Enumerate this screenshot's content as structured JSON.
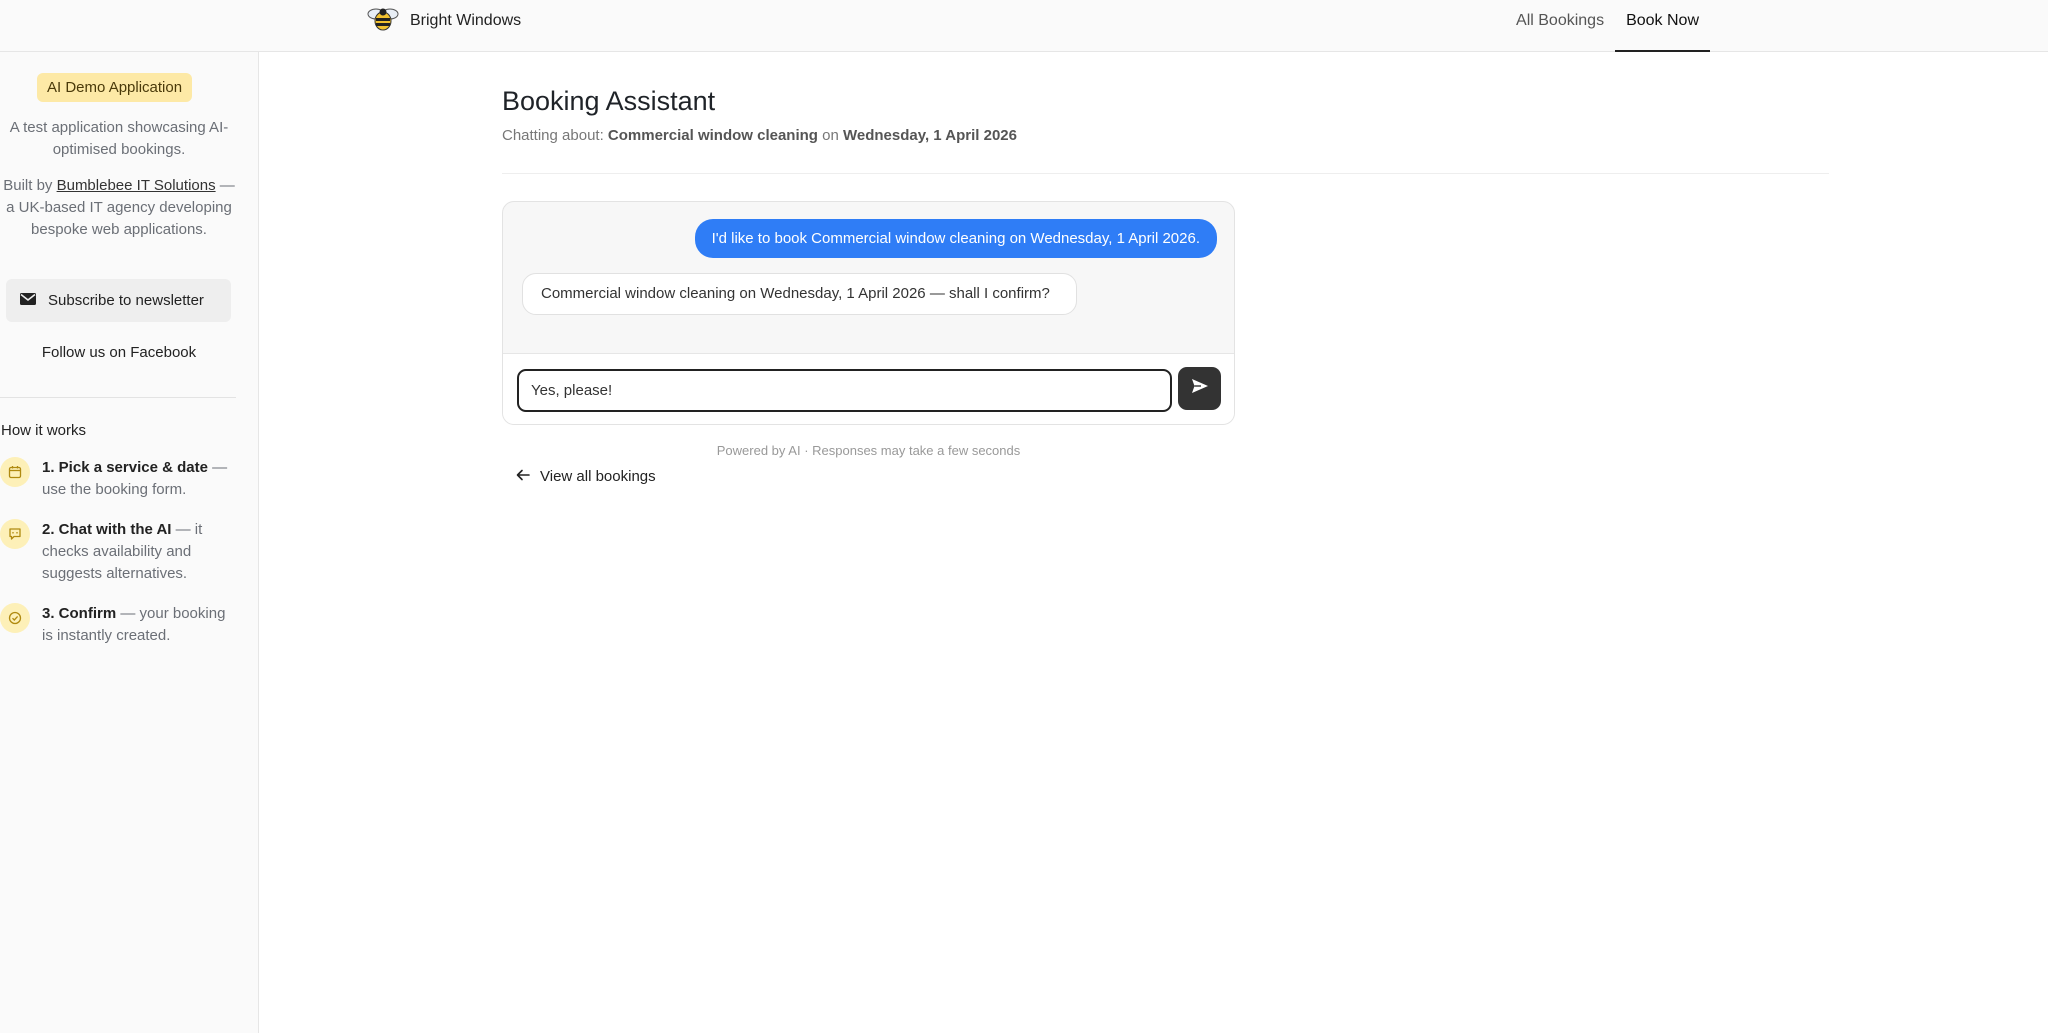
{
  "header": {
    "brand_name": "Bright Windows",
    "nav": [
      {
        "label": "All Bookings"
      },
      {
        "label": "Book Now"
      }
    ]
  },
  "sidebar": {
    "badge": "AI Demo Application",
    "description": "A test application showcasing AI-optimised bookings.",
    "built_by_prefix": "Built by ",
    "built_by_link": "Bumblebee IT Solutions",
    "built_by_suffix": " — a UK-based IT agency developing bespoke web applications.",
    "subscribe_label": "Subscribe to newsletter",
    "facebook_label": "Follow us on Facebook",
    "how_title": "How it works",
    "steps": [
      {
        "title": "1. Pick a service & date",
        "text": " — use the booking form."
      },
      {
        "title": "2. Chat with the AI",
        "text": " — it checks availability and suggests alternatives."
      },
      {
        "title": "3. Confirm",
        "text": " — your booking is instantly created."
      }
    ]
  },
  "main": {
    "title": "Booking Assistant",
    "subtitle_prefix": "Chatting about: ",
    "service": "Commercial window cleaning",
    "subtitle_mid": " on ",
    "date": "Wednesday, 1 April 2026",
    "messages": {
      "user": "I'd like to book Commercial window cleaning on Wednesday, 1 April 2026.",
      "assistant": "Commercial window cleaning on Wednesday, 1 April 2026 — shall I confirm?"
    },
    "input_value": "Yes, please!",
    "powered_text": "Powered by AI · Responses may take a few seconds",
    "back_link": "View all bookings"
  },
  "colors": {
    "accent_blue": "#2f7df6",
    "badge_yellow": "#fde9a6",
    "dark_button": "#333333"
  }
}
